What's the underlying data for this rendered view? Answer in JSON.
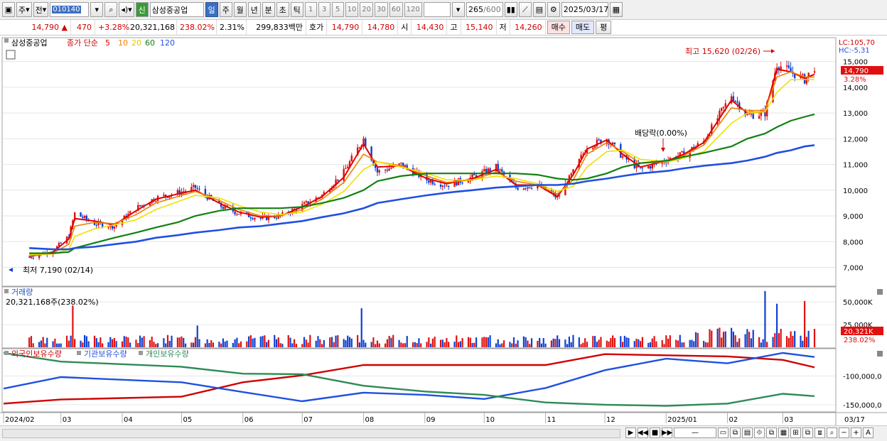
{
  "toolbar": {
    "period_unit": "주",
    "prev_label": "전",
    "stock_code": "010140",
    "credit_badge": "신",
    "stock_name": "삼성중공업",
    "periods": [
      "일",
      "주",
      "월",
      "년",
      "분",
      "초",
      "틱"
    ],
    "active_period": "일",
    "interval_buttons": [
      "1",
      "3",
      "5",
      "10",
      "20",
      "30",
      "60",
      "120"
    ],
    "data_count": "265",
    "data_count_max": "/600",
    "date": "2025/03/17"
  },
  "quote": {
    "price": "14,790",
    "change_arrow": "▲",
    "change": "470",
    "change_pct": "+3.28%",
    "volume": "20,321,168",
    "volume_ratio": "238.02%",
    "turnover": "2.31%",
    "amount": "299,833백만",
    "bid_label": "호가",
    "ask_price": "14,790",
    "bid_price": "14,780",
    "open_label": "시",
    "open": "14,430",
    "high_label": "고",
    "high": "15,140",
    "low_label": "저",
    "low": "14,260",
    "buy_label": "매수",
    "sell_label": "매도",
    "extra_label": "평"
  },
  "price_panel": {
    "name_tag": "삼성중공업",
    "legend_prefix": "종가 단순",
    "ma_labels": [
      "5",
      "10",
      "20",
      "60",
      "120"
    ],
    "lc": "LC:105,70",
    "hc": "HC:-5,31",
    "current_price": "14,790",
    "current_pct": "3.28%",
    "high_note": "최고 15,620 (02/26)",
    "low_note": "최저 7,190 (02/14)",
    "dividend_note": "배당락(0.00%)"
  },
  "volume_panel": {
    "title": "거래량",
    "value_label": "20,321,168주(238.02%)",
    "current": "20,321K",
    "current_pct": "238.02%"
  },
  "holdings_panel": {
    "labels": [
      "외국인보유수량",
      "기관보유수량",
      "개인보유수량"
    ]
  },
  "x_axis": {
    "labels": [
      "2024/02",
      "03",
      "04",
      "05",
      "06",
      "07",
      "08",
      "09",
      "10",
      "11",
      "12",
      "2025/01",
      "02",
      "03",
      "03/17"
    ]
  },
  "colors": {
    "up": "#e01010",
    "down": "#1040d0",
    "ma5": "#e00000",
    "ma10": "#f08000",
    "ma20": "#f0e000",
    "ma60": "#108010",
    "ma120": "#2050e0",
    "foreign": "#d00000",
    "institution": "#2050e0",
    "individual": "#2e8b57"
  },
  "chart_data": [
    {
      "type": "candlestick",
      "title": "삼성중공업",
      "y_ticks": [
        7000,
        8000,
        9000,
        10000,
        11000,
        12000,
        13000,
        14000,
        15000
      ],
      "y_tick_labels": [
        "7,000",
        "8,000",
        "9,000",
        "10,000",
        "11,000",
        "12,000",
        "13,000",
        "14,000",
        "15,000"
      ],
      "ylim": [
        6600,
        15900
      ],
      "close_path": {
        "dates": [
          "2024-02-14",
          "2024-02-26",
          "2024-03-05",
          "2024-03-08",
          "2024-03-18",
          "2024-03-28",
          "2024-04-08",
          "2024-04-18",
          "2024-04-29",
          "2024-05-08",
          "2024-05-20",
          "2024-05-30",
          "2024-06-10",
          "2024-06-20",
          "2024-07-01",
          "2024-07-11",
          "2024-07-22",
          "2024-08-01",
          "2024-08-08",
          "2024-08-20",
          "2024-09-02",
          "2024-09-12",
          "2024-09-25",
          "2024-10-07",
          "2024-10-17",
          "2024-10-28",
          "2024-11-07",
          "2024-11-15",
          "2024-11-22",
          "2024-12-02",
          "2024-12-10",
          "2024-12-19",
          "2025-01-02",
          "2025-01-10",
          "2025-01-20",
          "2025-02-03",
          "2025-02-11",
          "2025-02-20",
          "2025-02-26",
          "2025-03-05",
          "2025-03-12",
          "2025-03-17"
        ],
        "close": [
          7400,
          7650,
          8200,
          9100,
          8700,
          8600,
          9300,
          9700,
          9900,
          10100,
          9400,
          9100,
          8900,
          9000,
          9400,
          9800,
          10700,
          12000,
          10700,
          11000,
          10400,
          10200,
          10500,
          10900,
          10100,
          10200,
          9700,
          10700,
          11700,
          12000,
          11300,
          10800,
          11200,
          11400,
          11900,
          13700,
          12900,
          13000,
          14900,
          14600,
          14300,
          14790
        ]
      },
      "moving_averages": [
        {
          "name": "5",
          "values": [
            7420,
            7600,
            8100,
            8900,
            8800,
            8650,
            9200,
            9650,
            9850,
            10000,
            9500,
            9150,
            8950,
            9000,
            9350,
            9750,
            10500,
            11800,
            10900,
            10950,
            10450,
            10250,
            10450,
            10800,
            10200,
            10200,
            9750,
            10600,
            11600,
            11950,
            11400,
            10900,
            11150,
            11400,
            11850,
            13500,
            13000,
            13050,
            14700,
            14600,
            14350,
            14500
          ]
        },
        {
          "name": "10",
          "values": [
            7450,
            7550,
            7900,
            8600,
            8750,
            8700,
            9050,
            9500,
            9750,
            9950,
            9600,
            9250,
            9000,
            9000,
            9250,
            9650,
            10300,
            11400,
            11100,
            10950,
            10550,
            10300,
            10400,
            10700,
            10350,
            10200,
            9850,
            10400,
            11400,
            11850,
            11500,
            11050,
            11100,
            11350,
            11750,
            13200,
            13100,
            13100,
            14400,
            14600,
            14400,
            14400
          ]
        },
        {
          "name": "20",
          "values": [
            7500,
            7520,
            7700,
            8200,
            8500,
            8650,
            8850,
            9250,
            9550,
            9800,
            9700,
            9400,
            9150,
            9050,
            9150,
            9450,
            9950,
            10800,
            11100,
            10900,
            10650,
            10400,
            10400,
            10550,
            10450,
            10250,
            9950,
            10150,
            10900,
            11500,
            11550,
            11200,
            11100,
            11250,
            11500,
            12600,
            13000,
            13050,
            13800,
            14300,
            14300,
            14300
          ]
        },
        {
          "name": "60",
          "values": [
            7550,
            7550,
            7600,
            7750,
            7950,
            8150,
            8350,
            8550,
            8750,
            9000,
            9200,
            9300,
            9300,
            9300,
            9350,
            9500,
            9700,
            10000,
            10350,
            10550,
            10650,
            10650,
            10650,
            10650,
            10650,
            10600,
            10450,
            10400,
            10450,
            10650,
            10900,
            11050,
            11150,
            11300,
            11450,
            11700,
            12000,
            12200,
            12450,
            12700,
            12850,
            12950
          ]
        },
        {
          "name": "120",
          "values": [
            7750,
            7700,
            7700,
            7750,
            7800,
            7900,
            8000,
            8150,
            8250,
            8350,
            8450,
            8550,
            8600,
            8700,
            8800,
            8950,
            9100,
            9300,
            9500,
            9650,
            9800,
            9900,
            10000,
            10100,
            10150,
            10200,
            10200,
            10250,
            10350,
            10450,
            10550,
            10650,
            10750,
            10850,
            10950,
            11050,
            11150,
            11300,
            11450,
            11550,
            11700,
            11750
          ]
        }
      ],
      "annotations": [
        "최고 15,620 (02/26)",
        "최저 7,190 (02/14)",
        "배당락(0.00%)"
      ]
    },
    {
      "type": "bar",
      "title": "거래량",
      "y_ticks": [
        50000,
        25000
      ],
      "y_tick_labels": [
        "50,000K",
        "25,000K"
      ],
      "ylim": [
        0,
        65000
      ],
      "unit": "K shares",
      "spikes": [
        {
          "date": "2024-03-07",
          "value": 46000
        },
        {
          "date": "2024-05-09",
          "value": 24000
        },
        {
          "date": "2024-07-31",
          "value": 43000
        },
        {
          "date": "2025-02-20",
          "value": 62000
        },
        {
          "date": "2025-02-26",
          "value": 48000
        },
        {
          "date": "2025-03-12",
          "value": 51000
        },
        {
          "date": "2025-03-17",
          "value": 20321
        }
      ],
      "typical_level": 8000
    },
    {
      "type": "line",
      "title": "보유수량",
      "y_ticks": [
        -100000,
        -150000
      ],
      "y_tick_labels": [
        "-100,000,0",
        "-150,000,0"
      ],
      "series": [
        {
          "name": "외국인보유수량",
          "dates": [
            "2024-02",
            "2024-03",
            "2024-05",
            "2024-06",
            "2024-07",
            "2024-08",
            "2024-11",
            "2024-12",
            "2025-02",
            "2025-03",
            "2025-03-17"
          ],
          "values": [
            -148000,
            -141000,
            -136000,
            -111000,
            -99000,
            -81000,
            -81000,
            -62000,
            -66000,
            -72000,
            -85000
          ]
        },
        {
          "name": "기관보유수량",
          "dates": [
            "2024-02",
            "2024-03",
            "2024-05",
            "2024-06",
            "2024-07",
            "2024-08",
            "2024-09",
            "2024-10",
            "2024-11",
            "2024-12",
            "2025-01",
            "2025-02",
            "2025-03",
            "2025-03-17"
          ],
          "values": [
            -122000,
            -102000,
            -111000,
            -128000,
            -144000,
            -129000,
            -133000,
            -140000,
            -121000,
            -90000,
            -70000,
            -78000,
            -60000,
            -67000
          ]
        },
        {
          "name": "개인보유수량",
          "dates": [
            "2024-02",
            "2024-03",
            "2024-05",
            "2024-06",
            "2024-07",
            "2024-08",
            "2024-09",
            "2024-10",
            "2024-11",
            "2024-12",
            "2025-01",
            "2025-02",
            "2025-03",
            "2025-03-17"
          ],
          "values": [
            -60000,
            -75000,
            -84000,
            -96000,
            -97000,
            -117000,
            -127000,
            -133000,
            -146000,
            -150000,
            -152000,
            -148000,
            -131000,
            -135000
          ]
        }
      ]
    }
  ]
}
